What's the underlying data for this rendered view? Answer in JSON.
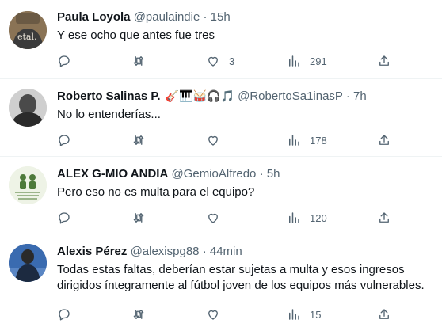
{
  "tweets": [
    {
      "name": "Paula Loyola",
      "emojis": "",
      "handle": "@paulaindie",
      "sep": "·",
      "time": "15h",
      "text": "Y ese ocho que antes fue tres",
      "replies": "",
      "retweets": "",
      "likes": "3",
      "views": "291",
      "avatar_text": "etal."
    },
    {
      "name": "Roberto Salinas P.",
      "emojis": "🎸🎹🥁🎧🎵",
      "handle": "@RobertoSa1inasP",
      "sep": "·",
      "time": "7h",
      "text": "No lo entenderías...",
      "replies": "",
      "retweets": "",
      "likes": "",
      "views": "178"
    },
    {
      "name": "ALEX G-MIO ANDIA",
      "emojis": "",
      "handle": "@GemioAlfredo",
      "sep": "·",
      "time": "5h",
      "text": "Pero eso no es multa para el equipo?",
      "replies": "",
      "retweets": "",
      "likes": "",
      "views": "120"
    },
    {
      "name": "Alexis Pérez",
      "emojis": "",
      "handle": "@alexispg88",
      "sep": "·",
      "time": "44min",
      "text": "Todas estas faltas, deberían estar sujetas a multa y esos ingresos dirigidos íntegramente al fútbol joven de los equipos más vulnerables.",
      "replies": "",
      "retweets": "",
      "likes": "",
      "views": "15"
    }
  ],
  "icons": {
    "reply": "reply-icon",
    "retweet": "retweet-icon",
    "like": "like-icon",
    "views": "views-icon",
    "share": "share-icon"
  },
  "colors": {
    "text": "#0f1419",
    "muted": "#536471",
    "divider": "#eff3f4"
  }
}
